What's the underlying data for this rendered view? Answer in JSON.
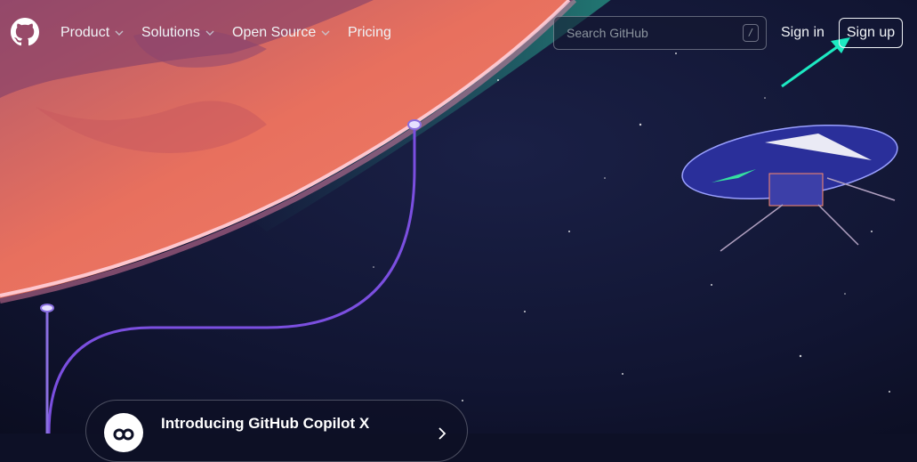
{
  "nav": {
    "items": [
      {
        "label": "Product",
        "has_dropdown": true
      },
      {
        "label": "Solutions",
        "has_dropdown": true
      },
      {
        "label": "Open Source",
        "has_dropdown": true
      },
      {
        "label": "Pricing",
        "has_dropdown": false
      }
    ]
  },
  "search": {
    "placeholder": "Search GitHub",
    "shortcut": "/"
  },
  "auth": {
    "sign_in": "Sign in",
    "sign_up": "Sign up"
  },
  "promo": {
    "title": "Introducing GitHub Copilot X"
  },
  "icons": {
    "logo": "github-mark-icon",
    "dropdown": "chevron-down-icon",
    "promo": "copilot-icon",
    "promo_arrow": "chevron-right-icon"
  },
  "colors": {
    "space": "#0d1026",
    "planet": "#e8705e",
    "planet_rim": "#ff8ab0",
    "aurora": "#2ecfa8",
    "trail": "#7b4fe0",
    "annotation_arrow": "#1de9c2"
  }
}
